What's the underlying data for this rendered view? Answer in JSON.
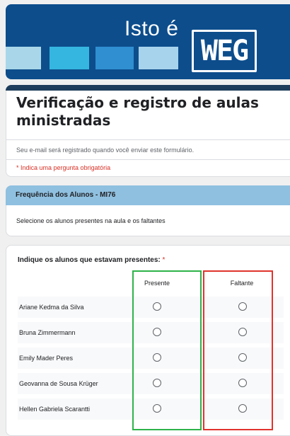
{
  "banner": {
    "tagline": "Isto é",
    "logo_text": "WEG"
  },
  "form": {
    "title": "Verificação e registro de aulas ministradas",
    "email_notice": "Seu e-mail será registrado quando você enviar este formulário.",
    "required_notice": "* Indica uma pergunta obrigatória"
  },
  "section": {
    "title": "Frequência dos Alunos - MI76",
    "description": "Selecione os alunos presentes na aula e os faltantes"
  },
  "question": {
    "label": "Indique os alunos que estavam presentes:",
    "required_mark": "*",
    "columns": [
      "Presente",
      "Faltante"
    ],
    "rows": [
      "Ariane Kedma da Silva",
      "Bruna Zimmermann",
      "Emily Mader Peres",
      "Geovanna de Sousa Krüger",
      "Hellen Gabriela Scarantti"
    ]
  },
  "colors": {
    "banner": "#0d4d8c",
    "section_header": "#8fc0e0",
    "highlight_present": "#2eb34a",
    "highlight_absent": "#e0332c",
    "required": "#d93025"
  }
}
